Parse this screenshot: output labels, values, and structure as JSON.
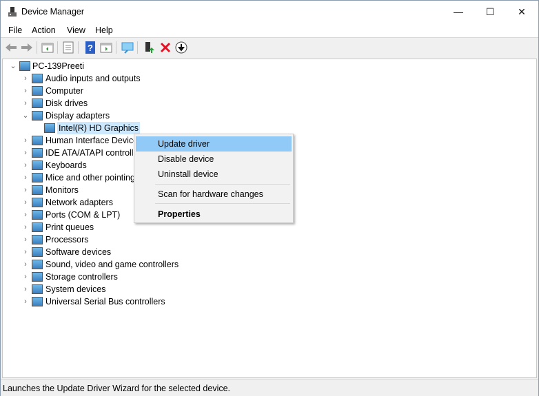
{
  "window": {
    "title": "Device Manager",
    "minimize": "—",
    "maximize": "☐",
    "close": "✕"
  },
  "menu": [
    "File",
    "Action",
    "View",
    "Help"
  ],
  "toolbar": [
    "back-icon",
    "forward-icon",
    "show-hide-console-tree-icon",
    "properties-icon",
    "help-icon",
    "action-pane-icon",
    "scan-hardware-icon",
    "update-driver-icon",
    "uninstall-icon",
    "disable-icon"
  ],
  "tree": {
    "root": "PC-139Preeti",
    "categories": [
      "Audio inputs and outputs",
      "Computer",
      "Disk drives",
      "Display adapters",
      "Human Interface Devices",
      "IDE ATA/ATAPI controllers",
      "Keyboards",
      "Mice and other pointing devices",
      "Monitors",
      "Network adapters",
      "Ports (COM & LPT)",
      "Print queues",
      "Processors",
      "Software devices",
      "Sound, video and game controllers",
      "Storage controllers",
      "System devices",
      "Universal Serial Bus controllers"
    ],
    "expanded": "Display adapters",
    "selected_child": "Intel(R) HD Graphics"
  },
  "context_menu": {
    "items": [
      "Update driver",
      "Disable device",
      "Uninstall device",
      "Scan for hardware changes",
      "Properties"
    ],
    "highlighted": "Update driver"
  },
  "status": "Launches the Update Driver Wizard for the selected device.",
  "colors": {
    "selection": "#cce8ff",
    "menu_highlight": "#91c9f7",
    "delete_red": "#e81123"
  }
}
